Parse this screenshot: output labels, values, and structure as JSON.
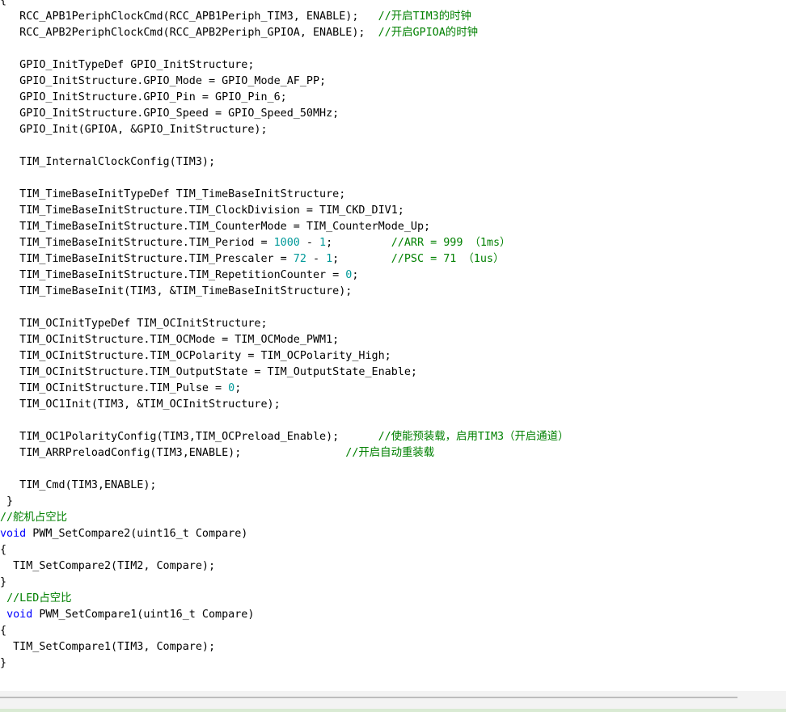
{
  "colors": {
    "keyword": "#0000ff",
    "number": "#009999",
    "comment": "#008000",
    "text": "#000000",
    "background": "#ffffff"
  },
  "code_lines": [
    [
      {
        "t": "{",
        "c": "id"
      }
    ],
    [
      {
        "t": "   RCC_APB1PeriphClockCmd(RCC_APB1Periph_TIM3, ENABLE);   ",
        "c": "id"
      },
      {
        "t": "//开启TIM3的时钟",
        "c": "cm"
      }
    ],
    [
      {
        "t": "   RCC_APB2PeriphClockCmd(RCC_APB2Periph_GPIOA, ENABLE);  ",
        "c": "id"
      },
      {
        "t": "//开启GPIOA的时钟",
        "c": "cm"
      }
    ],
    [],
    [
      {
        "t": "   GPIO_InitTypeDef GPIO_InitStructure;",
        "c": "id"
      }
    ],
    [
      {
        "t": "   GPIO_InitStructure.GPIO_Mode = GPIO_Mode_AF_PP;",
        "c": "id"
      }
    ],
    [
      {
        "t": "   GPIO_InitStructure.GPIO_Pin = GPIO_Pin_6;",
        "c": "id"
      }
    ],
    [
      {
        "t": "   GPIO_InitStructure.GPIO_Speed = GPIO_Speed_50MHz;",
        "c": "id"
      }
    ],
    [
      {
        "t": "   GPIO_Init(GPIOA, &GPIO_InitStructure);",
        "c": "id"
      }
    ],
    [],
    [
      {
        "t": "   TIM_InternalClockConfig(TIM3);",
        "c": "id"
      }
    ],
    [],
    [
      {
        "t": "   TIM_TimeBaseInitTypeDef TIM_TimeBaseInitStructure;",
        "c": "id"
      }
    ],
    [
      {
        "t": "   TIM_TimeBaseInitStructure.TIM_ClockDivision = TIM_CKD_DIV1;",
        "c": "id"
      }
    ],
    [
      {
        "t": "   TIM_TimeBaseInitStructure.TIM_CounterMode = TIM_CounterMode_Up;",
        "c": "id"
      }
    ],
    [
      {
        "t": "   TIM_TimeBaseInitStructure.TIM_Period = ",
        "c": "id"
      },
      {
        "t": "1000",
        "c": "num"
      },
      {
        "t": " - ",
        "c": "id"
      },
      {
        "t": "1",
        "c": "num"
      },
      {
        "t": ";         ",
        "c": "id"
      },
      {
        "t": "//ARR = 999 （1ms）",
        "c": "cm"
      }
    ],
    [
      {
        "t": "   TIM_TimeBaseInitStructure.TIM_Prescaler = ",
        "c": "id"
      },
      {
        "t": "72",
        "c": "num"
      },
      {
        "t": " - ",
        "c": "id"
      },
      {
        "t": "1",
        "c": "num"
      },
      {
        "t": ";        ",
        "c": "id"
      },
      {
        "t": "//PSC = 71 （1us）",
        "c": "cm"
      }
    ],
    [
      {
        "t": "   TIM_TimeBaseInitStructure.TIM_RepetitionCounter = ",
        "c": "id"
      },
      {
        "t": "0",
        "c": "num"
      },
      {
        "t": ";",
        "c": "id"
      }
    ],
    [
      {
        "t": "   TIM_TimeBaseInit(TIM3, &TIM_TimeBaseInitStructure);",
        "c": "id"
      }
    ],
    [],
    [
      {
        "t": "   TIM_OCInitTypeDef TIM_OCInitStructure;",
        "c": "id"
      }
    ],
    [
      {
        "t": "   TIM_OCInitStructure.TIM_OCMode = TIM_OCMode_PWM1;",
        "c": "id"
      }
    ],
    [
      {
        "t": "   TIM_OCInitStructure.TIM_OCPolarity = TIM_OCPolarity_High;",
        "c": "id"
      }
    ],
    [
      {
        "t": "   TIM_OCInitStructure.TIM_OutputState = TIM_OutputState_Enable;",
        "c": "id"
      }
    ],
    [
      {
        "t": "   TIM_OCInitStructure.TIM_Pulse = ",
        "c": "id"
      },
      {
        "t": "0",
        "c": "num"
      },
      {
        "t": ";",
        "c": "id"
      }
    ],
    [
      {
        "t": "   TIM_OC1Init(TIM3, &TIM_OCInitStructure);",
        "c": "id"
      }
    ],
    [],
    [
      {
        "t": "   TIM_OC1PolarityConfig(TIM3,TIM_OCPreload_Enable);      ",
        "c": "id"
      },
      {
        "t": "//使能预装载，启用TIM3（开启通道）",
        "c": "cm"
      }
    ],
    [
      {
        "t": "   TIM_ARRPreloadConfig(TIM3,ENABLE);                ",
        "c": "id"
      },
      {
        "t": "//开启自动重装载",
        "c": "cm"
      }
    ],
    [],
    [
      {
        "t": "   TIM_Cmd(TIM3,ENABLE);",
        "c": "id"
      }
    ],
    [
      {
        "t": " }",
        "c": "id"
      }
    ],
    [
      {
        "t": "//舵机占空比",
        "c": "cm"
      }
    ],
    [
      {
        "t": "void",
        "c": "kw"
      },
      {
        "t": " PWM_SetCompare2(uint16_t Compare)",
        "c": "id"
      }
    ],
    [
      {
        "t": "{",
        "c": "id"
      }
    ],
    [
      {
        "t": "  TIM_SetCompare2(TIM2, Compare);",
        "c": "id"
      }
    ],
    [
      {
        "t": "}",
        "c": "id"
      }
    ],
    [
      {
        "t": " ",
        "c": "id"
      },
      {
        "t": "//LED占空比",
        "c": "cm"
      }
    ],
    [
      {
        "t": " ",
        "c": "id"
      },
      {
        "t": "void",
        "c": "kw"
      },
      {
        "t": " PWM_SetCompare1(uint16_t Compare)",
        "c": "id"
      }
    ],
    [
      {
        "t": "{",
        "c": "id"
      }
    ],
    [
      {
        "t": "  TIM_SetCompare1(TIM3, Compare);",
        "c": "id"
      }
    ],
    [
      {
        "t": "}",
        "c": "id"
      }
    ]
  ]
}
